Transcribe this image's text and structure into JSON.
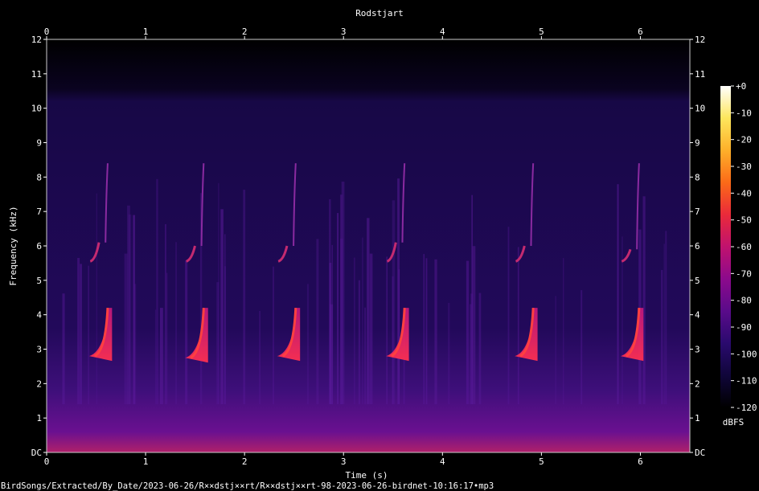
{
  "chart_data": {
    "type": "heatmap",
    "title": "Rodstjart",
    "xlabel": "Time (s)",
    "ylabel": "Frequency (kHz)",
    "xlim": [
      0,
      6.5
    ],
    "ylim": [
      0,
      12
    ],
    "x_ticks": [
      "0",
      "1",
      "2",
      "3",
      "4",
      "5",
      "6"
    ],
    "y_ticks": [
      "DC",
      "1",
      "2",
      "3",
      "4",
      "5",
      "6",
      "7",
      "8",
      "9",
      "10",
      "11",
      "12"
    ],
    "colorbar": {
      "label": "dBFS",
      "range": [
        -120,
        0
      ],
      "ticks": [
        "+0",
        "-10",
        "-20",
        "-30",
        "-40",
        "-50",
        "-60",
        "-70",
        "-80",
        "-90",
        "-100",
        "-110",
        "-120"
      ],
      "colors": [
        "#000000",
        "#10063a",
        "#2a0a6e",
        "#5a0b8a",
        "#8c0a8c",
        "#c0126e",
        "#ea2a3a",
        "#fb6a18",
        "#fdb02a",
        "#fde65c",
        "#ffffff"
      ]
    },
    "calls": [
      {
        "start": 0.43,
        "low_khz": 2.8,
        "high_khz": 6.1
      },
      {
        "start": 1.4,
        "low_khz": 2.75,
        "high_khz": 6.0
      },
      {
        "start": 2.33,
        "low_khz": 2.8,
        "high_khz": 6.0
      },
      {
        "start": 3.43,
        "low_khz": 2.8,
        "high_khz": 6.1
      },
      {
        "start": 4.73,
        "low_khz": 2.8,
        "high_khz": 6.0
      },
      {
        "start": 5.8,
        "low_khz": 2.8,
        "high_khz": 5.9
      }
    ]
  },
  "footer": {
    "filename": "BirdSongs/Extracted/By_Date/2023-06-26/R××dstj××rt/R××dstj××rt-98-2023-06-26-birdnet-10:16:17•mp3"
  }
}
